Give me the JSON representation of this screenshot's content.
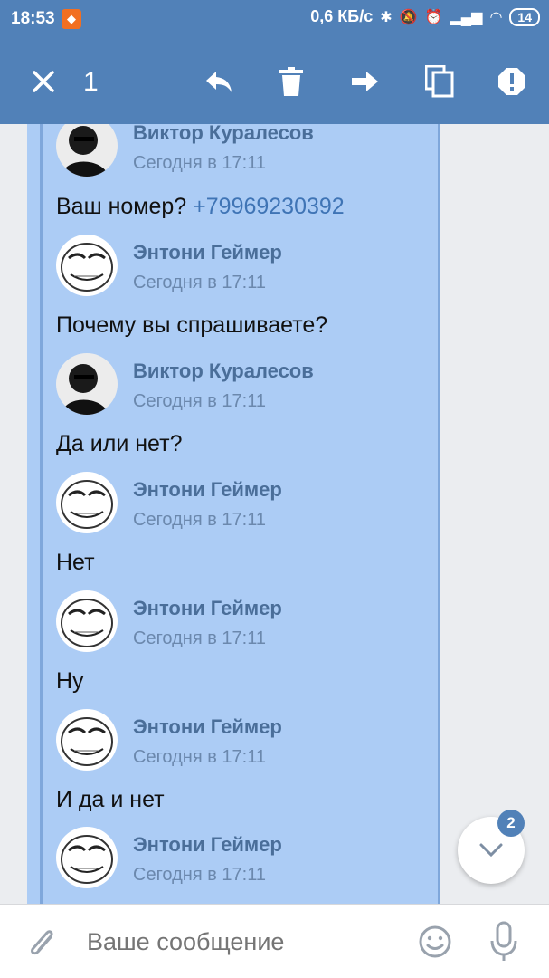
{
  "status": {
    "time": "18:53",
    "net_speed": "0,6 КБ/с",
    "battery": "14"
  },
  "action_bar": {
    "selected_count": "1"
  },
  "messages": [
    {
      "author": "Виктор Куралесов",
      "time": "Сегодня в 17:11",
      "avatar": "man-photo",
      "text": "Ваш номер?",
      "phone": "+79969230392"
    },
    {
      "author": "Энтони Геймер",
      "time": "Сегодня в 17:11",
      "avatar": "meme-face",
      "text": "Почему вы спрашиваете?"
    },
    {
      "author": "Виктор Куралесов",
      "time": "Сегодня в 17:11",
      "avatar": "man-photo",
      "text": "Да или нет?"
    },
    {
      "author": "Энтони Геймер",
      "time": "Сегодня в 17:11",
      "avatar": "meme-face",
      "text": "Нет"
    },
    {
      "author": "Энтони Геймер",
      "time": "Сегодня в 17:11",
      "avatar": "meme-face",
      "text": "Ну"
    },
    {
      "author": "Энтони Геймер",
      "time": "Сегодня в 17:11",
      "avatar": "meme-face",
      "text": "И да и нет"
    },
    {
      "author": "Энтони Геймер",
      "time": "Сегодня в 17:11",
      "avatar": "meme-face",
      "text": ""
    }
  ],
  "scroll_fab": {
    "badge": "2"
  },
  "composer": {
    "placeholder": "Ваше сообщение"
  },
  "colors": {
    "accent": "#5181b8",
    "selection": "#acccf5"
  }
}
